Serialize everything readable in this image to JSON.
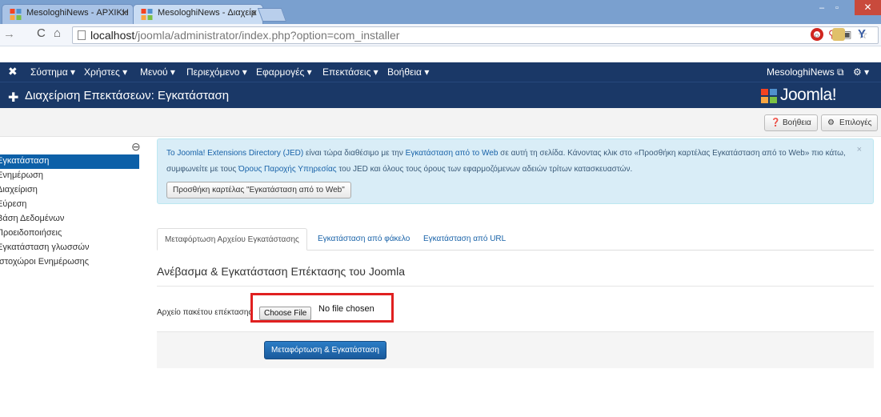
{
  "browser": {
    "tabs": [
      {
        "title": "MesologhiNews - ΑΡΧΙΚΗ",
        "active": false
      },
      {
        "title": "MesologhiNews - Διαχείρ",
        "active": true
      }
    ],
    "url_host": "localhost",
    "url_path": "/joomla/administrator/index.php?option=com_installer"
  },
  "admin_nav": {
    "menu": [
      "Σύστημα ▾",
      "Χρήστες ▾",
      "Μενού ▾",
      "Περιεχόμενο ▾",
      "Εφαρμογές ▾",
      "Επεκτάσεις ▾",
      "Βοήθεια ▾"
    ],
    "site_link": "MesologhiNews",
    "settings_caret": "▾"
  },
  "title_bar": {
    "title": "Διαχείριση Επεκτάσεων: Εγκατάσταση",
    "brand": "Joomla!"
  },
  "subtoolbar": {
    "help_label": "Βοήθεια",
    "options_label": "Επιλογές"
  },
  "sidebar": {
    "items": [
      {
        "label": "Εγκατάσταση",
        "active": true
      },
      {
        "label": "Ενημέρωση",
        "active": false
      },
      {
        "label": "Διαχείριση",
        "active": false
      },
      {
        "label": "Εύρεση",
        "active": false
      },
      {
        "label": "Βάση Δεδομένων",
        "active": false
      },
      {
        "label": "Προειδοποιήσεις",
        "active": false
      },
      {
        "label": "Εγκατάσταση γλωσσών",
        "active": false
      },
      {
        "label": "Ιστοχώροι Ενημέρωσης",
        "active": false
      }
    ]
  },
  "alert": {
    "line1_a": "To Joomla! Extensions Directory (JED)",
    "line1_b": " είναι τώρα διαθέσιμο με την ",
    "line1_link": "Εγκατάσταση από το Web",
    "line1_c": " σε αυτή τη σελίδα.  Κάνοντας κλικ στο «Προσθήκη καρτέλας Εγκατάσταση από το Web» πιο κάτω,",
    "line2_a": "συμφωνείτε με τους ",
    "line2_link": "Όρους Παροχής Υπηρεσίας",
    "line2_b": " του JED και όλους τους όρους των εφαρμοζόμενων αδειών τρίτων κατασκευαστών.",
    "button": "Προσθήκη καρτέλας \"Εγκατάσταση από το Web\"",
    "close": "×"
  },
  "tabs": [
    {
      "label": "Μεταφόρτωση Αρχείου Εγκατάστασης",
      "active": true
    },
    {
      "label": "Εγκατάσταση από φάκελο",
      "active": false
    },
    {
      "label": "Εγκατάσταση από URL",
      "active": false
    }
  ],
  "upload": {
    "legend": "Ανέβασμα & Εγκατάσταση Επέκτασης του Joomla",
    "field_label": "Αρχείο πακέτου επέκτασης",
    "file_button": "Choose File",
    "file_status": "No file chosen",
    "submit": "Μεταφόρτωση & Εγκατάσταση"
  },
  "colors": {
    "admin_navy": "#1a3867",
    "active_blue": "#0d60a8",
    "alert_bg": "#d9edf7",
    "highlight_red": "#e02020"
  }
}
